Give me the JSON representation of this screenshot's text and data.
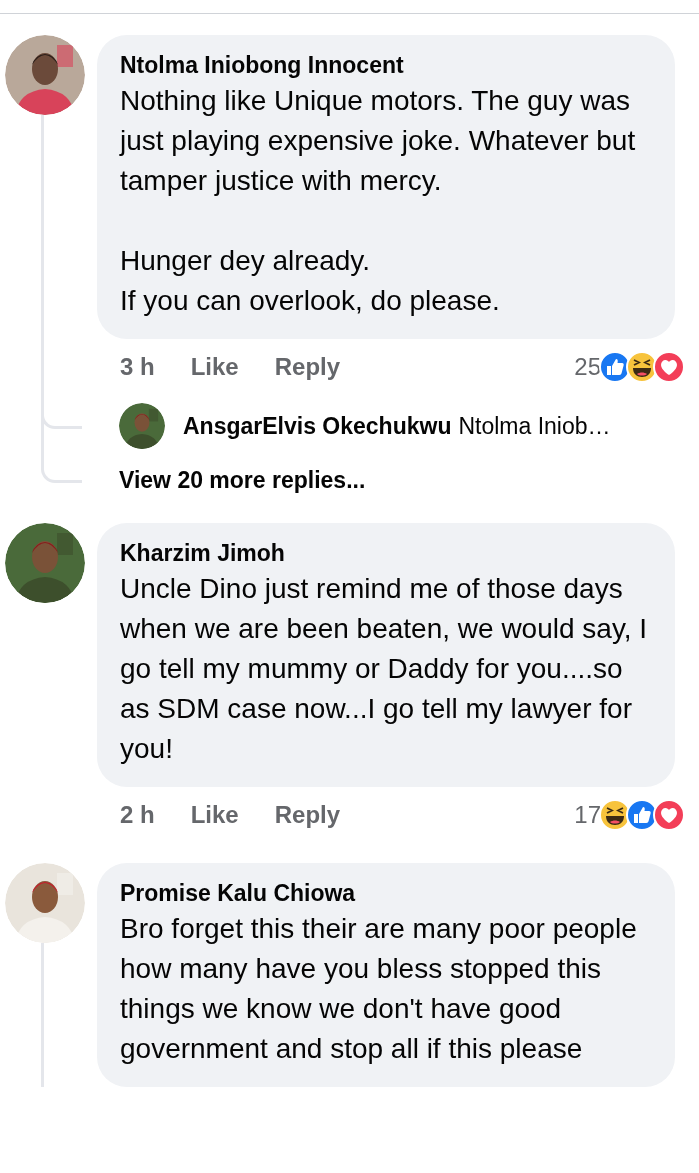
{
  "comments": [
    {
      "author": "Ntolma Iniobong Innocent",
      "text": "Nothing like Unique motors. The guy was just playing expensive joke. Whatever but tamper justice with mercy.\n\nHunger dey already.\nIf you can overlook, do please.",
      "thread": true,
      "meta": {
        "time": "3 h",
        "like": "Like",
        "reply": "Reply",
        "reaction_count": "25",
        "reactions": [
          {
            "kind": "like"
          },
          {
            "kind": "haha"
          },
          {
            "kind": "love"
          }
        ]
      },
      "reply_preview": {
        "author": "AnsgarElvis Okechukwu",
        "text": "Ntolma Iniob…"
      },
      "view_more": "View 20 more replies..."
    },
    {
      "author": "Kharzim Jimoh",
      "text": "Uncle Dino just remind me of those days when we are been beaten, we would say, I go tell my mummy or Daddy for you....so as SDM case now...I go tell my lawyer for you!",
      "thread": false,
      "meta": {
        "time": "2 h",
        "like": "Like",
        "reply": "Reply",
        "reaction_count": "17",
        "reactions": [
          {
            "kind": "haha"
          },
          {
            "kind": "like"
          },
          {
            "kind": "love"
          }
        ]
      }
    },
    {
      "author": "Promise Kalu Chiowa",
      "text": "Bro forget this their are many poor people how many have you bless stopped this things we know we don't have good government and stop all if this please",
      "thread": true
    }
  ]
}
